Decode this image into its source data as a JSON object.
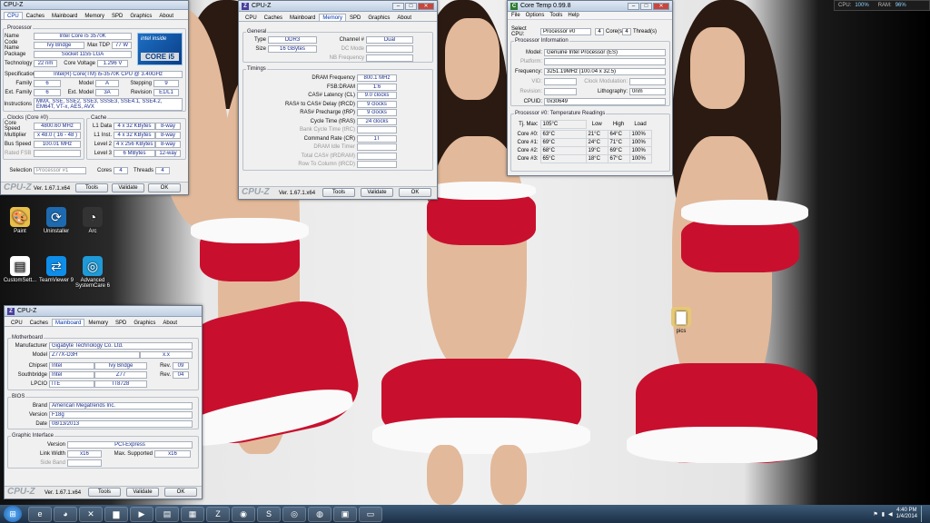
{
  "meter": {
    "cpu_label": "CPU:",
    "cpu_value": "100%",
    "ram_label": "RAM:",
    "ram_value": "96%"
  },
  "desktop_icons": [
    {
      "label": "Paint",
      "icon": "paint-icon"
    },
    {
      "label": "Uninstaller",
      "icon": "uninstaller-icon"
    },
    {
      "label": "Arc",
      "icon": "arc-icon"
    },
    {
      "label": "CustomSett...",
      "icon": "document-icon"
    },
    {
      "label": "TeamViewer 9",
      "icon": "teamviewer-icon"
    },
    {
      "label": "Advanced SystemCare 6",
      "icon": "systemcare-icon"
    },
    {
      "label": "pics",
      "icon": "folder-icon"
    }
  ],
  "cpuz1": {
    "title": "CPU-Z",
    "tabs": [
      "CPU",
      "Caches",
      "Mainboard",
      "Memory",
      "SPD",
      "Graphics",
      "About"
    ],
    "processor_label": "Processor",
    "name_l": "Name",
    "name_v": "Intel Core i5 3570K",
    "code_l": "Code Name",
    "code_v": "Ivy Bridge",
    "tdp_l": "Max TDP",
    "tdp_v": "77 W",
    "pkg_l": "Package",
    "pkg_v": "Socket 1155 LGA",
    "tech_l": "Technology",
    "tech_v": "22 nm",
    "cv_l": "Core Voltage",
    "cv_v": "1.296 V",
    "spec_l": "Specification",
    "spec_v": "Intel(R) Core(TM) i5-3570K CPU @ 3.40GHz",
    "fam_l": "Family",
    "fam_v": "6",
    "mod_l": "Model",
    "mod_v": "A",
    "step_l": "Stepping",
    "step_v": "9",
    "efam_l": "Ext. Family",
    "efam_v": "6",
    "emod_l": "Ext. Model",
    "emod_v": "3A",
    "rev_l": "Revision",
    "rev_v": "E1/L1",
    "ins_l": "Instructions",
    "ins_v": "MMX, SSE, SSE2, SSE3, SSSE3, SSE4.1, SSE4.2, EM64T, VT-x, AES, AVX",
    "logo_inside": "intel inside",
    "logo_core": "CORE i5",
    "clocks_label": "Clocks (Core #0)",
    "cs_l": "Core Speed",
    "cs_v": "4800.60 MHz",
    "mul_l": "Multiplier",
    "mul_v": "x 48.0 ( 16 - 48 )",
    "bus_l": "Bus Speed",
    "bus_v": "100.01 MHz",
    "fsb_l": "Rated FSB",
    "fsb_v": "",
    "caches_label": "Cache",
    "l1d_l": "L1 Data",
    "l1d_v": "4 x 32 KBytes",
    "l1d_w": "8-way",
    "l1i_l": "L1 Inst.",
    "l1i_v": "4 x 32 KBytes",
    "l1i_w": "8-way",
    "l2_l": "Level 2",
    "l2_v": "4 x 256 KBytes",
    "l2_w": "8-way",
    "l3_l": "Level 3",
    "l3_v": "6 MBytes",
    "l3_w": "12-way",
    "sel_l": "Selection",
    "sel_v": "Processor #1",
    "cores_l": "Cores",
    "cores_v": "4",
    "thr_l": "Threads",
    "thr_v": "4",
    "logo": "CPU-Z",
    "ver": "Ver. 1.67.1.x64",
    "tools": "Tools",
    "validate": "Validate",
    "ok": "OK"
  },
  "cpuz2": {
    "title": "CPU-Z",
    "tabs": [
      "CPU",
      "Caches",
      "Mainboard",
      "Memory",
      "SPD",
      "Graphics",
      "About"
    ],
    "general_label": "General",
    "type_l": "Type",
    "type_v": "DDR3",
    "ch_l": "Channel #",
    "ch_v": "Dual",
    "size_l": "Size",
    "size_v": "16 GBytes",
    "dc_l": "DC Mode",
    "dc_v": "",
    "nb_l": "NB Frequency",
    "nb_v": "",
    "timings_label": "Timings",
    "t": [
      {
        "l": "DRAM Frequency",
        "v": "800.1 MHz",
        "dim": false
      },
      {
        "l": "FSB:DRAM",
        "v": "1:6",
        "dim": false
      },
      {
        "l": "CAS# Latency (CL)",
        "v": "9.0 clocks",
        "dim": false
      },
      {
        "l": "RAS# to CAS# Delay (tRCD)",
        "v": "9 clocks",
        "dim": false
      },
      {
        "l": "RAS# Precharge (tRP)",
        "v": "9 clocks",
        "dim": false
      },
      {
        "l": "Cycle Time (tRAS)",
        "v": "24 clocks",
        "dim": false
      },
      {
        "l": "Bank Cycle Time (tRC)",
        "v": "",
        "dim": true
      },
      {
        "l": "Command Rate (CR)",
        "v": "1T",
        "dim": false
      },
      {
        "l": "DRAM Idle Timer",
        "v": "",
        "dim": true
      },
      {
        "l": "Total CAS# (tRDRAM)",
        "v": "",
        "dim": true
      },
      {
        "l": "Row To Column (tRCD)",
        "v": "",
        "dim": true
      }
    ],
    "logo": "CPU-Z",
    "ver": "Ver. 1.67.1.x64",
    "tools": "Tools",
    "validate": "Validate",
    "ok": "OK"
  },
  "cpuz3": {
    "title": "CPU-Z",
    "tabs": [
      "CPU",
      "Caches",
      "Mainboard",
      "Memory",
      "SPD",
      "Graphics",
      "About"
    ],
    "mb_label": "Motherboard",
    "man_l": "Manufacturer",
    "man_v": "Gigabyte Technology Co. Ltd.",
    "model_l": "Model",
    "model_v": "Z77X-D3H",
    "model_x": "x.x",
    "chip_l": "Chipset",
    "chip_v1": "Intel",
    "chip_v2": "Ivy Bridge",
    "chip_rl": "Rev.",
    "chip_r": "09",
    "sb_l": "Southbridge",
    "sb_v1": "Intel",
    "sb_v2": "Z77",
    "sb_rl": "Rev.",
    "sb_r": "04",
    "lpc_l": "LPCIO",
    "lpc_v1": "ITE",
    "lpc_v2": "IT8728",
    "bios_label": "BIOS",
    "brand_l": "Brand",
    "brand_v": "American Megatrends Inc.",
    "bver_l": "Version",
    "bver_v": "F18g",
    "date_l": "Date",
    "date_v": "08/13/2013",
    "gi_label": "Graphic Interface",
    "gv_l": "Version",
    "gv_v": "PCI-Express",
    "lw_l": "Link Width",
    "lw_v": "x16",
    "ms_l": "Max. Supported",
    "ms_v": "x16",
    "sbd_l": "Side Band",
    "sbd_v": "",
    "logo": "CPU-Z",
    "ver": "Ver. 1.67.1.x64",
    "tools": "Tools",
    "validate": "Validate",
    "ok": "OK"
  },
  "coretemp": {
    "title": "Core Temp 0.99.8",
    "menu": [
      "File",
      "Options",
      "Tools",
      "Help"
    ],
    "sel_l": "Select CPU:",
    "sel_v": "Processor #0",
    "cores_v": "4",
    "cores_l": "Core(s)",
    "thr_v": "4",
    "thr_l": "Thread(s)",
    "pi_label": "Processor Information",
    "model_l": "Model:",
    "model_v": "Genuine Intel Processor (ES)",
    "plat_l": "Platform:",
    "plat_v": "",
    "freq_l": "Frequency:",
    "freq_v": "3251.19MHz (100.04 x 32.5)",
    "vid_l": "VID:",
    "vid_v": "",
    "cm_l": "Clock Modulation:",
    "cm_v": "",
    "rev_l": "Revision:",
    "rev_v": "",
    "lith_l": "Lithography:",
    "lith_v": "0nm",
    "cpuid_l": "CPUID:",
    "cpuid_v": "0x30649",
    "temp_label": "Processor #0: Temperature Readings",
    "tjmax_l": "Tj. Max:",
    "tjmax_v": "105°C",
    "h_low": "Low",
    "h_high": "High",
    "h_load": "Load",
    "cores": [
      {
        "n": "Core #0:",
        "t": "63°C",
        "lo": "21°C",
        "hi": "64°C",
        "ld": "100%"
      },
      {
        "n": "Core #1:",
        "t": "69°C",
        "lo": "24°C",
        "hi": "71°C",
        "ld": "100%"
      },
      {
        "n": "Core #2:",
        "t": "68°C",
        "lo": "19°C",
        "hi": "69°C",
        "ld": "100%"
      },
      {
        "n": "Core #3:",
        "t": "65°C",
        "lo": "18°C",
        "hi": "67°C",
        "ld": "100%"
      }
    ]
  },
  "taskbar": {
    "apps": [
      "ie-icon",
      "firefox-icon",
      "xbox-icon",
      "explorer-icon",
      "media-icon",
      "app-icon",
      "chart-icon",
      "cpuz-icon",
      "network-icon",
      "skype-icon",
      "origin-icon",
      "steam-icon",
      "monitor-icon",
      "screen-icon"
    ],
    "time": "4:40 PM",
    "date": "1/4/2014"
  }
}
